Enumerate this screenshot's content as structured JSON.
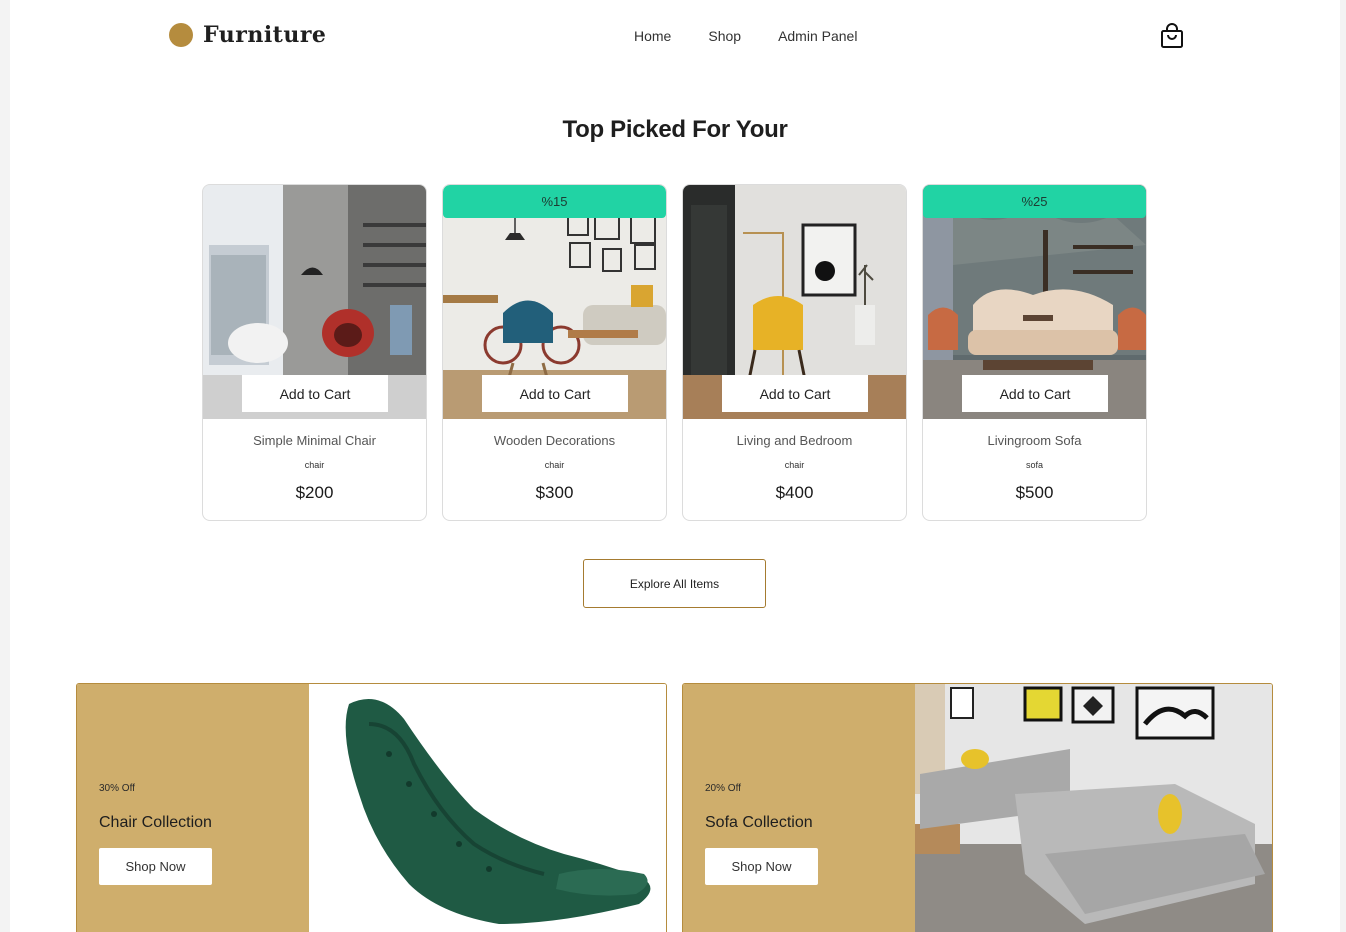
{
  "header": {
    "logo_text": "Furniture",
    "nav": [
      "Home",
      "Shop",
      "Admin Panel"
    ]
  },
  "section_title": "Top Picked For Your",
  "products": [
    {
      "name": "Simple Minimal Chair",
      "category": "chair",
      "price": "$200",
      "badge": "",
      "button": "Add to Cart"
    },
    {
      "name": "Wooden Decorations",
      "category": "chair",
      "price": "$300",
      "badge": "%15",
      "button": "Add to Cart"
    },
    {
      "name": "Living and Bedroom",
      "category": "chair",
      "price": "$400",
      "badge": "",
      "button": "Add to Cart"
    },
    {
      "name": "Livingroom Sofa",
      "category": "sofa",
      "price": "$500",
      "badge": "%25",
      "button": "Add to Cart"
    }
  ],
  "explore_button": "Explore All Items",
  "promos": [
    {
      "off": "30% Off",
      "title": "Chair Collection",
      "button": "Shop Now"
    },
    {
      "off": "20% Off",
      "title": "Sofa Collection",
      "button": "Shop Now"
    }
  ],
  "colors": {
    "brand": "#b58c3e",
    "badge": "#21d3a4",
    "promo_panel": "#cfae6c"
  },
  "icons": {
    "cart": "shopping-bag-icon"
  }
}
